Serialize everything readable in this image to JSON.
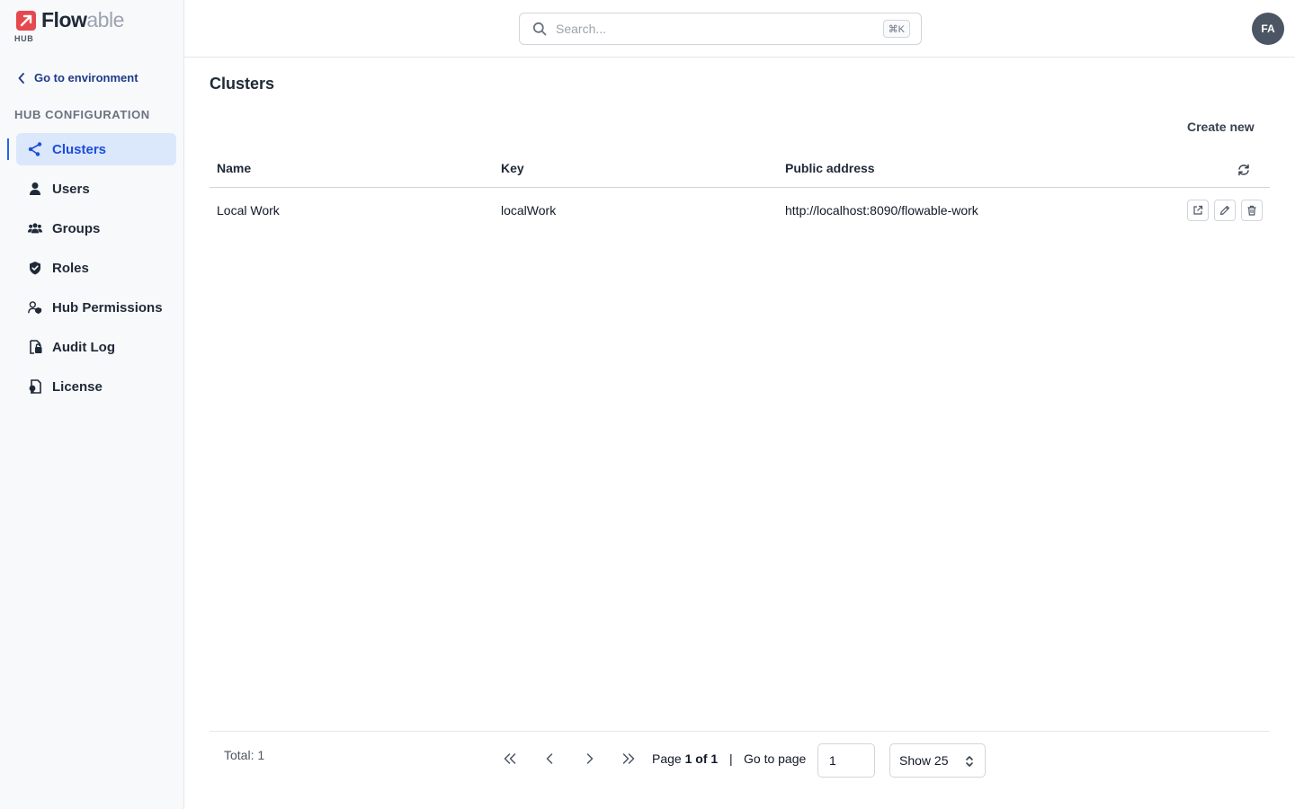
{
  "brand": {
    "name_bold": "Flow",
    "name_light": "able",
    "sub": "HUB"
  },
  "sidebar": {
    "back_label": "Go to environment",
    "section_title": "HUB CONFIGURATION",
    "items": [
      {
        "label": "Clusters",
        "icon": "cluster-icon",
        "active": true
      },
      {
        "label": "Users",
        "icon": "user-icon"
      },
      {
        "label": "Groups",
        "icon": "groups-icon"
      },
      {
        "label": "Roles",
        "icon": "shield-icon"
      },
      {
        "label": "Hub Permissions",
        "icon": "user-permission-icon"
      },
      {
        "label": "Audit Log",
        "icon": "audit-log-icon"
      },
      {
        "label": "License",
        "icon": "license-icon"
      }
    ]
  },
  "header": {
    "search_placeholder": "Search...",
    "search_shortcut": "⌘K",
    "avatar_initials": "FA"
  },
  "main": {
    "title": "Clusters",
    "create_label": "Create new",
    "columns": [
      "Name",
      "Key",
      "Public address"
    ],
    "rows": [
      {
        "name": "Local Work",
        "key": "localWork",
        "address": "http://localhost:8090/flowable-work"
      }
    ]
  },
  "footer": {
    "total_label": "Total: 1",
    "page_prefix": "Page ",
    "page_value": "1 of 1",
    "separator": "|",
    "goto_label": "Go to page",
    "goto_value": "1",
    "show_label": "Show 25"
  },
  "colors": {
    "accent": "#1d4ed8",
    "active_bg": "#dbe7fb",
    "brand": "#e5484d"
  }
}
